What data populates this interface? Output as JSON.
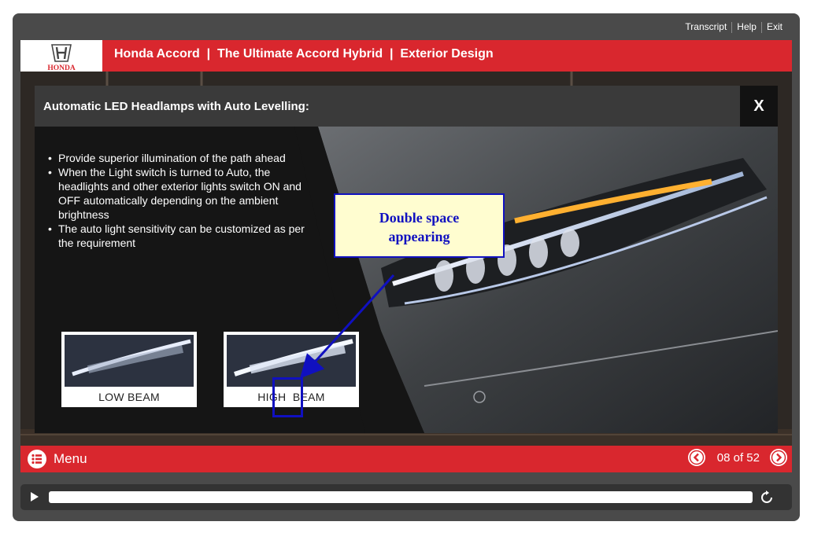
{
  "top_links": {
    "transcript": "Transcript",
    "help": "Help",
    "exit": "Exit"
  },
  "header": {
    "brand": "HONDA",
    "title": "Honda Accord  |  The Ultimate Accord Hybrid  |  Exterior Design"
  },
  "popup": {
    "title": "Automatic LED Headlamps with Auto Levelling:",
    "close_label": "X",
    "bullets": [
      "Provide superior illumination of the path ahead",
      "When the Light switch is turned to Auto, the headlights and other exterior lights switch ON and OFF automatically depending on the ambient brightness",
      "The auto light sensitivity can be customized as per the requirement"
    ],
    "thumbnails": [
      {
        "label": "LOW BEAM"
      },
      {
        "label": "HIGH  BEAM"
      }
    ]
  },
  "annotation": {
    "text_line1": "Double space",
    "text_line2": "appearing"
  },
  "bottom_bar": {
    "menu_label": "Menu",
    "page_count": "08 of 52"
  },
  "controls": {
    "progress": 0.0
  },
  "colors": {
    "brand_red": "#d9272e",
    "annotation_blue": "#1010c0",
    "annotation_fill": "#fffdd0"
  },
  "icons": [
    "menu-icon",
    "prev-icon",
    "next-icon",
    "play-icon",
    "replay-icon",
    "honda-logo-icon"
  ]
}
